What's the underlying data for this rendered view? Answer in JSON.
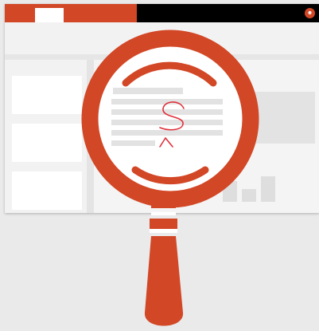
{
  "colors": {
    "accent": "#d24726",
    "titlebar": "#000000",
    "background": "#eaeaea",
    "handwriting": "#e0303a"
  },
  "icons": {
    "main": "magnifying-glass-icon",
    "avatar": "user-avatar-icon"
  },
  "handwriting": {
    "letter": "S",
    "caret": "^"
  }
}
